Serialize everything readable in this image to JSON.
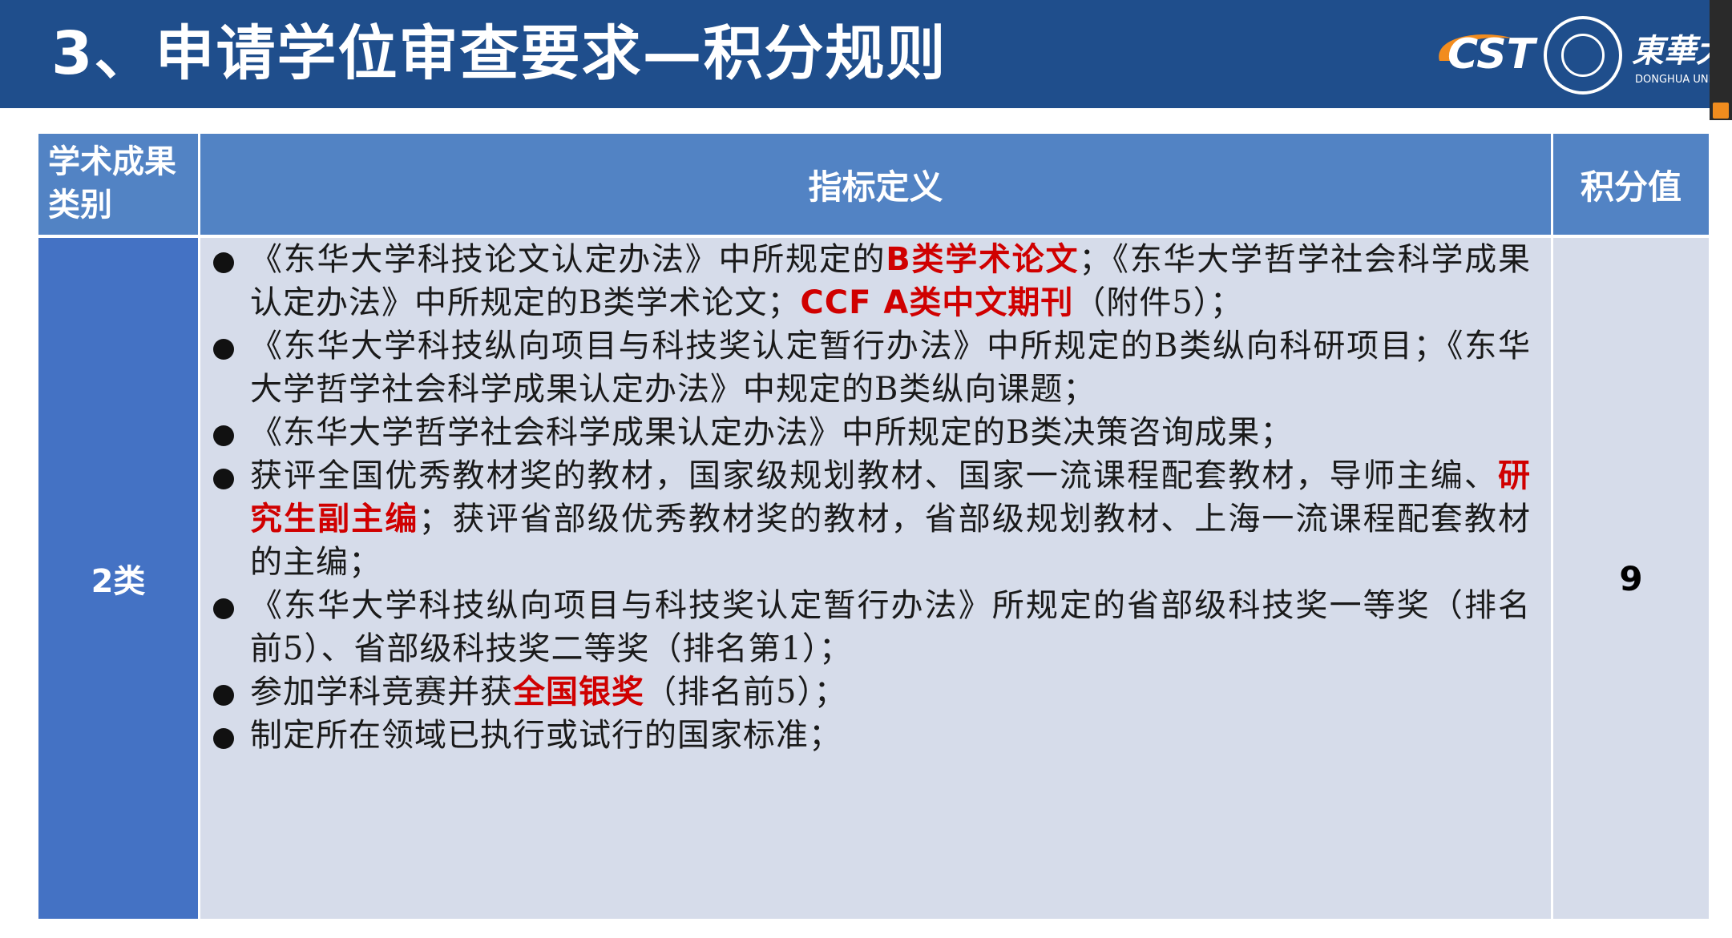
{
  "header": {
    "title": "3、申请学位审查要求—积分规则",
    "logo_cst": "CST",
    "university_name": "東華大",
    "university_en": "DONGHUA UNIVE"
  },
  "table": {
    "headers": [
      "学术成果类别",
      "指标定义",
      "积分值"
    ],
    "category": "2类",
    "score": "9",
    "items": [
      {
        "parts": [
          {
            "t": "《东华大学科技论文认定办法》中所规定的"
          },
          {
            "t": "B类学术论文",
            "hl": true
          },
          {
            "t": "；《东华大学哲学社会科学成果认定办法》中所规定的B类学术论文；"
          },
          {
            "t": "CCF A类中文期刊",
            "hl": true
          },
          {
            "t": "（附件5）；"
          }
        ]
      },
      {
        "parts": [
          {
            "t": "《东华大学科技纵向项目与科技奖认定暂行办法》中所规定的B类纵向科研项目；《东华大学哲学社会科学成果认定办法》中规定的B类纵向课题；"
          }
        ]
      },
      {
        "parts": [
          {
            "t": "《东华大学哲学社会科学成果认定办法》中所规定的B类决策咨询成果；"
          }
        ]
      },
      {
        "parts": [
          {
            "t": "获评全国优秀教材奖的教材，国家级规划教材、国家一流课程配套教材，导师主编、"
          },
          {
            "t": "研究生副主编",
            "hl": true
          },
          {
            "t": "；获评省部级优秀教材奖的教材，省部级规划教材、上海一流课程配套教材的主编；"
          }
        ]
      },
      {
        "parts": [
          {
            "t": "《东华大学科技纵向项目与科技奖认定暂行办法》所规定的省部级科技奖一等奖（排名前5）、省部级科技奖二等奖（排名第1）；"
          }
        ]
      },
      {
        "parts": [
          {
            "t": "参加学科竞赛并获"
          },
          {
            "t": "全国银奖",
            "hl": true
          },
          {
            "t": "（排名前5）；"
          }
        ]
      },
      {
        "parts": [
          {
            "t": "制定所在领域已执行或试行的国家标准；"
          }
        ]
      }
    ]
  }
}
